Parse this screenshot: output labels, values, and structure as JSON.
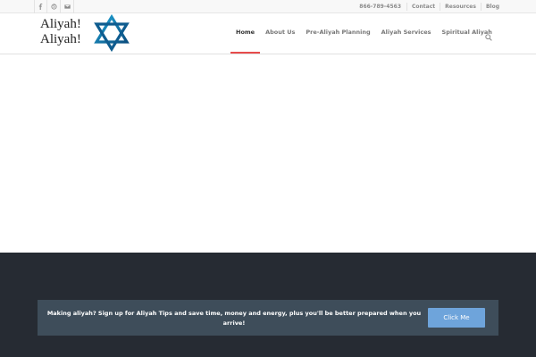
{
  "topbar": {
    "social": [
      {
        "icon": "facebook-icon"
      },
      {
        "icon": "skype-icon"
      },
      {
        "icon": "mail-icon"
      }
    ],
    "phone": "866-789-4563",
    "links": [
      "Contact",
      "Resources",
      "Blog"
    ]
  },
  "logo": {
    "line1": "Aliyah!",
    "line2": "Aliyah!",
    "icon": "star-of-david-icon"
  },
  "nav": {
    "items": [
      "Home",
      "About Us",
      "Pre-Aliyah Planning",
      "Aliyah Services",
      "Spiritual Aliyah"
    ],
    "active": "Home",
    "search_icon": "search-icon"
  },
  "colors": {
    "active_underline": "#e74c4c",
    "footer_bg": "#262b33",
    "cta_bg": "#3e4d5a",
    "button_bg": "#6ea4db"
  },
  "cta": {
    "text": "Making aliyah?  Sign up for Aliyah Tips and save time, money and energy, plus you'll be better prepared when you arrive!",
    "button": "Click Me"
  }
}
